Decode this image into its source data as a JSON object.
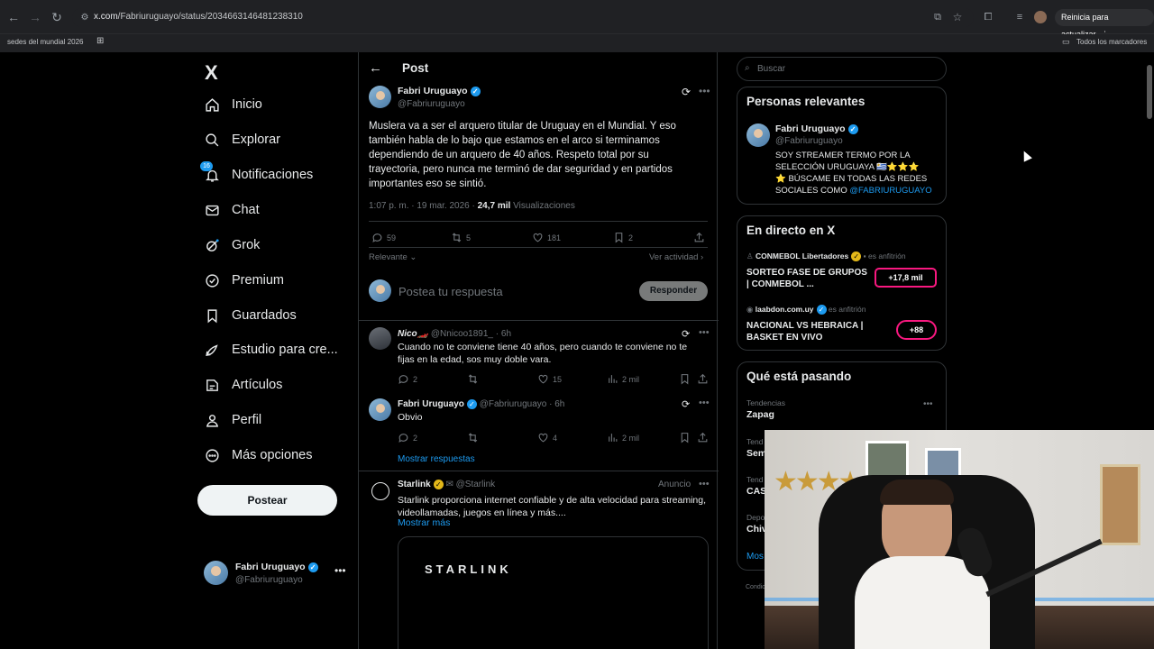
{
  "browser": {
    "url_prefix": "x.com",
    "url_path": "/Fabriuruguayo/status/2034663146481238310",
    "update_button": "Reinicia para actualizar",
    "bookmark_left": "sedes del mundial 2026",
    "bookmark_right": "Todos los marcadores"
  },
  "nav": {
    "logo": "X",
    "items": [
      {
        "label": "Inicio",
        "icon": "home-icon"
      },
      {
        "label": "Explorar",
        "icon": "search-icon"
      },
      {
        "label": "Notificaciones",
        "icon": "bell-icon",
        "badge": "16"
      },
      {
        "label": "Chat",
        "icon": "mail-icon"
      },
      {
        "label": "Grok",
        "icon": "grok-icon"
      },
      {
        "label": "Premium",
        "icon": "premium-icon"
      },
      {
        "label": "Guardados",
        "icon": "bookmark-icon"
      },
      {
        "label": "Estudio para cre...",
        "icon": "rocket-icon"
      },
      {
        "label": "Artículos",
        "icon": "article-icon"
      },
      {
        "label": "Perfil",
        "icon": "person-icon"
      },
      {
        "label": "Más opciones",
        "icon": "more-circle-icon"
      }
    ],
    "post_button": "Postear",
    "me_name": "Fabri Uruguayo",
    "me_handle": "@Fabriuruguayo"
  },
  "post": {
    "header": "Post",
    "author_name": "Fabri Uruguayo",
    "author_handle": "@Fabriuruguayo",
    "text": "Muslera va a ser el arquero titular de Uruguay en el Mundial. Y eso también habla de lo bajo que estamos en el arco si terminamos dependiendo de un arquero de 40 años. Respeto total por su trayectoria, pero nunca me terminó de dar seguridad y en partidos importantes eso se sintió.",
    "time": "1:07 p. m. · 19 mar. 2026 · ",
    "views_count": "24,7 mil",
    "views_label": " Visualizaciones",
    "replies": "59",
    "reposts": "5",
    "likes": "181",
    "bookmarks": "2",
    "relevant": "Relevante",
    "see_activity": "Ver actividad",
    "reply_placeholder": "Postea tu respuesta",
    "reply_button": "Responder"
  },
  "replies": [
    {
      "name": "Nico🏎️",
      "handle": "@Nnicoo1891_",
      "time": " · 6h",
      "text": "Cuando no te conviene tiene 40 años, pero cuando te conviene no te fijas en la edad, sos muy doble vara.",
      "replies": "2",
      "reposts": "",
      "likes": "15",
      "views": "2 mil"
    },
    {
      "name": "Fabri Uruguayo",
      "handle": "@Fabriuruguayo",
      "time": " · 6h",
      "text": "Obvio",
      "replies": "2",
      "reposts": "",
      "likes": "4",
      "views": "2 mil"
    }
  ],
  "show_replies": "Mostrar respuestas",
  "ad": {
    "name": "Starlink",
    "handle": "@Starlink",
    "tag": "Anuncio",
    "text": "Starlink proporciona internet confiable y de alta velocidad para streaming, videollamadas, juegos en línea y más....",
    "more": "Mostrar más",
    "media_text": "STARLINK"
  },
  "right": {
    "search_placeholder": "Buscar",
    "relevant_title": "Personas relevantes",
    "rel_name": "Fabri Uruguayo",
    "rel_handle": "@Fabriuruguayo",
    "rel_bio_1": "SOY STREAMER TERMO POR LA",
    "rel_bio_2": "SELECCIÓN URUGUAYA 🇺🇾⭐⭐⭐",
    "rel_bio_3": "⭐ BÚSCAME EN TODAS LAS REDES",
    "rel_bio_4": "SOCIALES COMO ",
    "rel_bio_link": "@FABRIURUGUAYO",
    "live_title": "En directo en X",
    "live": [
      {
        "host": "CONMEBOL Libertadores",
        "role": "es anfitrión",
        "title_1": "SORTEO FASE DE GRUPOS",
        "title_2": "| CONMEBOL ...",
        "count": "+17,8 mil"
      },
      {
        "host": "laabdon.com.uy",
        "role": "es anfitrión",
        "title_1": "NACIONAL VS HEBRAICA |",
        "title_2": "BASKET EN VIVO",
        "count": "+88"
      }
    ],
    "trending_title": "Qué está pasando",
    "trend_cat": "Tendencias",
    "trend_name": "Zapag",
    "trend_rows": [
      "Tend",
      "Sem",
      "Tend",
      "CAS",
      "Depo",
      "Chiv"
    ],
    "show_more": "Mos",
    "footer_stub": "Condic"
  }
}
